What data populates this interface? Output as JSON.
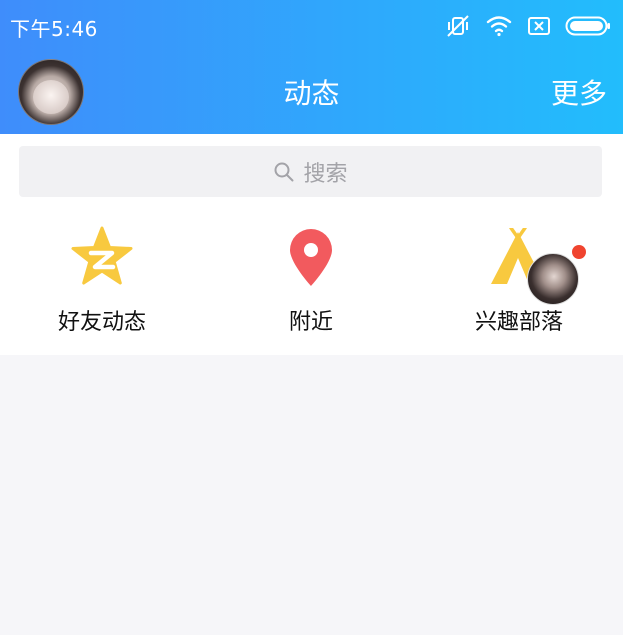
{
  "status_bar": {
    "time": "下午5:46",
    "icons": [
      "vibrate-mute-icon",
      "wifi-icon",
      "sim-icon",
      "battery-icon"
    ]
  },
  "nav": {
    "title": "动态",
    "more_label": "更多",
    "avatar": "user-avatar"
  },
  "search": {
    "placeholder": "搜索",
    "icon": "search-icon"
  },
  "shortcuts": [
    {
      "label": "好友动态",
      "icon": "qzone-star-icon",
      "color": "#f8c93f"
    },
    {
      "label": "附近",
      "icon": "location-pin-icon",
      "color": "#f25a5e"
    },
    {
      "label": "兴趣部落",
      "icon": "tent-icon",
      "color": "#f8c93f",
      "badge": true
    }
  ],
  "colors": {
    "header_gradient_start": "#3f8dfb",
    "header_gradient_end": "#22bdfc",
    "background": "#f6f6f9",
    "badge": "#f0442f"
  }
}
